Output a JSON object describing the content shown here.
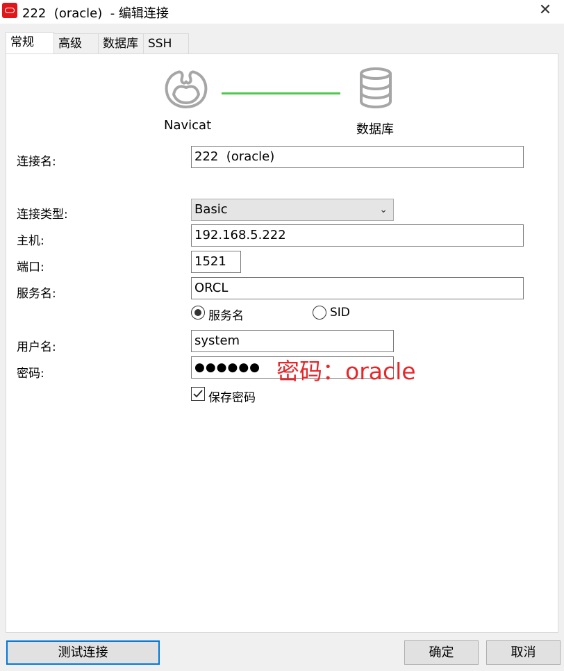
{
  "window": {
    "title": "222  (oracle)  - 编辑连接",
    "close_icon": "✕"
  },
  "tabs": [
    {
      "label": "常规"
    },
    {
      "label": "高级"
    },
    {
      "label": "数据库"
    },
    {
      "label": "SSH"
    }
  ],
  "header": {
    "left_label": "Navicat",
    "right_label": "数据库",
    "left_icon": "navicat-icon",
    "right_icon": "database-icon",
    "connector_color": "#4cc84c"
  },
  "form": {
    "connection_name": {
      "label": "连接名:",
      "value": "222  (oracle)"
    },
    "connection_type": {
      "label": "连接类型:",
      "value": "Basic"
    },
    "host": {
      "label": "主机:",
      "value": "192.168.5.222"
    },
    "port": {
      "label": "端口:",
      "value": "1521"
    },
    "service_name": {
      "label": "服务名:",
      "value": "ORCL"
    },
    "radio_service_name": {
      "label": "服务名",
      "selected": true
    },
    "radio_sid": {
      "label": "SID",
      "selected": false
    },
    "username": {
      "label": "用户名:",
      "value": "system"
    },
    "password": {
      "label": "密码:",
      "value": "●●●●●●"
    },
    "save_password": {
      "label": "保存密码",
      "checked": true
    }
  },
  "annotation": {
    "text": "密码：oracle",
    "color": "#e8262a"
  },
  "buttons": {
    "test": "测试连接",
    "ok": "确定",
    "cancel": "取消"
  }
}
